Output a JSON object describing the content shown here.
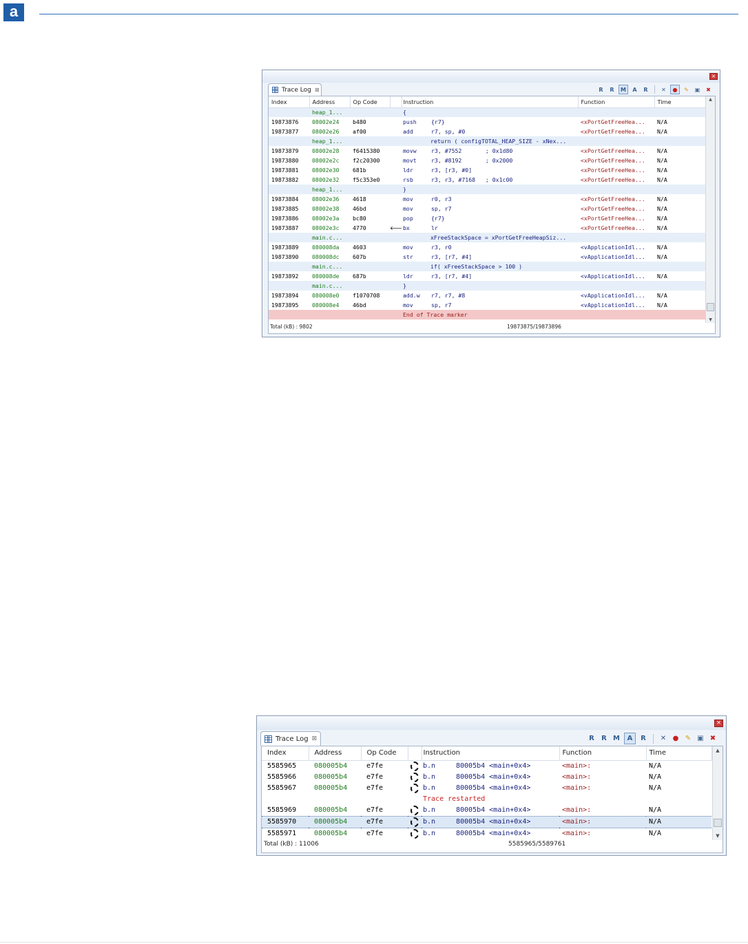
{
  "header": {
    "logo_text": "a"
  },
  "window1": {
    "tab_label": "Trace Log",
    "tab_close": "⊠",
    "columns": [
      "Index",
      "Address",
      "Op Code",
      "",
      "Instruction",
      "Function",
      "Time"
    ],
    "rows": [
      {
        "kind": "src",
        "idx": "",
        "addr": "heap_1...",
        "op": "",
        "mn": "",
        "ins": "{",
        "fn": "",
        "time": ""
      },
      {
        "kind": "ins",
        "idx": "19873876",
        "addr": "08002e24",
        "op": "b480",
        "mn": "push",
        "ins": "{r7}",
        "fn": "<xPortGetFreeHea...",
        "time": "N/A"
      },
      {
        "kind": "ins",
        "idx": "19873877",
        "addr": "08002e26",
        "op": "af00",
        "mn": "add",
        "ins": "r7, sp, #0",
        "fn": "<xPortGetFreeHea...",
        "time": "N/A"
      },
      {
        "kind": "src",
        "idx": "",
        "addr": "heap_1...",
        "op": "",
        "mn": "",
        "ins": "return ( configTOTAL_HEAP_SIZE - xNex...",
        "fn": "",
        "time": ""
      },
      {
        "kind": "ins",
        "idx": "19873879",
        "addr": "08002e28",
        "op": "f6415380",
        "mn": "movw",
        "ins": "r3, #7552       ; 0x1d80",
        "fn": "<xPortGetFreeHea...",
        "time": "N/A"
      },
      {
        "kind": "ins",
        "idx": "19873880",
        "addr": "08002e2c",
        "op": "f2c20300",
        "mn": "movt",
        "ins": "r3, #8192       ; 0x2000",
        "fn": "<xPortGetFreeHea...",
        "time": "N/A"
      },
      {
        "kind": "ins",
        "idx": "19873881",
        "addr": "08002e30",
        "op": "681b",
        "mn": "ldr",
        "ins": "r3, [r3, #0]",
        "fn": "<xPortGetFreeHea...",
        "time": "N/A"
      },
      {
        "kind": "ins",
        "idx": "19873882",
        "addr": "08002e32",
        "op": "f5c353e0",
        "mn": "rsb",
        "ins": "r3, r3, #7168   ; 0x1c00",
        "fn": "<xPortGetFreeHea...",
        "time": "N/A"
      },
      {
        "kind": "src",
        "idx": "",
        "addr": "heap_1...",
        "op": "",
        "mn": "",
        "ins": "}",
        "fn": "",
        "time": ""
      },
      {
        "kind": "ins",
        "idx": "19873884",
        "addr": "08002e36",
        "op": "4618",
        "mn": "mov",
        "ins": "r0, r3",
        "fn": "<xPortGetFreeHea...",
        "time": "N/A"
      },
      {
        "kind": "ins",
        "idx": "19873885",
        "addr": "08002e38",
        "op": "46bd",
        "mn": "mov",
        "ins": "sp, r7",
        "fn": "<xPortGetFreeHea...",
        "time": "N/A"
      },
      {
        "kind": "ins",
        "idx": "19873886",
        "addr": "08002e3a",
        "op": "bc80",
        "mn": "pop",
        "ins": "{r7}",
        "fn": "<xPortGetFreeHea...",
        "time": "N/A"
      },
      {
        "kind": "ins",
        "idx": "19873887",
        "addr": "08002e3c",
        "op": "4770",
        "arrow": "🡐",
        "mn": "bx",
        "ins": "lr",
        "fn": "<xPortGetFreeHea...",
        "time": "N/A"
      },
      {
        "kind": "src",
        "idx": "",
        "addr": "main.c...",
        "op": "",
        "mn": "",
        "ins": "xFreeStackSpace = xPortGetFreeHeapSiz...",
        "fn": "",
        "time": ""
      },
      {
        "kind": "ins",
        "idx": "19873889",
        "addr": "080008da",
        "op": "4603",
        "mn": "mov",
        "ins": "r3, r0",
        "fn": "<vApplicationIdl...",
        "time": "N/A"
      },
      {
        "kind": "ins",
        "idx": "19873890",
        "addr": "080008dc",
        "op": "607b",
        "mn": "str",
        "ins": "r3, [r7, #4]",
        "fn": "<vApplicationIdl...",
        "time": "N/A"
      },
      {
        "kind": "src",
        "idx": "",
        "addr": "main.c...",
        "op": "",
        "mn": "",
        "ins": "if( xFreeStackSpace > 100 )",
        "fn": "",
        "time": ""
      },
      {
        "kind": "ins",
        "idx": "19873892",
        "addr": "080008de",
        "op": "687b",
        "mn": "ldr",
        "ins": "r3, [r7, #4]",
        "fn": "<vApplicationIdl...",
        "time": "N/A"
      },
      {
        "kind": "src",
        "idx": "",
        "addr": "main.c...",
        "op": "",
        "mn": "",
        "ins": "}",
        "fn": "",
        "time": ""
      },
      {
        "kind": "ins",
        "idx": "19873894",
        "addr": "080008e0",
        "op": "f1070708",
        "mn": "add.w",
        "ins": "r7, r7, #8",
        "fn": "<vApplicationIdl...",
        "time": "N/A"
      },
      {
        "kind": "ins",
        "idx": "19873895",
        "addr": "080008e4",
        "op": "46bd",
        "mn": "mov",
        "ins": "sp, r7",
        "fn": "<vApplicationIdl...",
        "time": "N/A"
      },
      {
        "kind": "eot",
        "idx": "",
        "addr": "",
        "op": "",
        "mn": "End of Trace marker",
        "ins": "",
        "fn": "",
        "time": ""
      }
    ],
    "status_left": "Total (kB) : 9802",
    "status_right": "19873875/19873896"
  },
  "window2": {
    "tab_label": "Trace Log",
    "tab_close": "⊠",
    "columns": [
      "Index",
      "Address",
      "Op Code",
      "",
      "Instruction",
      "Function",
      "Time"
    ],
    "rows": [
      {
        "kind": "ins",
        "idx": "5585965",
        "addr": "080005b4",
        "op": "e7fe",
        "mn": "b.n",
        "ins": "80005b4 <main+0x4>",
        "fn": "<main>:",
        "time": "N/A"
      },
      {
        "kind": "ins",
        "idx": "5585966",
        "addr": "080005b4",
        "op": "e7fe",
        "mn": "b.n",
        "ins": "80005b4 <main+0x4>",
        "fn": "<main>:",
        "time": "N/A"
      },
      {
        "kind": "ins",
        "idx": "5585967",
        "addr": "080005b4",
        "op": "e7fe",
        "mn": "b.n",
        "ins": "80005b4 <main+0x4>",
        "fn": "<main>:",
        "time": "N/A"
      },
      {
        "kind": "restart",
        "idx": "",
        "addr": "",
        "op": "",
        "mn": "Trace restarted",
        "ins": "",
        "fn": "",
        "time": ""
      },
      {
        "kind": "ins",
        "idx": "5585969",
        "addr": "080005b4",
        "op": "e7fe",
        "mn": "b.n",
        "ins": "80005b4 <main+0x4>",
        "fn": "<main>:",
        "time": "N/A"
      },
      {
        "kind": "sel",
        "idx": "5585970",
        "addr": "080005b4",
        "op": "e7fe",
        "mn": "b.n",
        "ins": "80005b4 <main+0x4>",
        "fn": "<main>:",
        "time": "N/A"
      },
      {
        "kind": "ins",
        "idx": "5585971",
        "addr": "080005b4",
        "op": "e7fe",
        "mn": "b.n",
        "ins": "80005b4 <main+0x4>",
        "fn": "<main>:",
        "time": "N/A"
      }
    ],
    "status_left": "Total (kB) : 11006",
    "status_right": "5585965/5589761"
  },
  "toolbar_icons": [
    "zoom-prev-icon",
    "zoom-next-icon",
    "mark-icon",
    "active-filter-icon",
    "reset-icon",
    "settings-icon",
    "record-icon",
    "pin-icon",
    "save-icon",
    "delete-icon"
  ],
  "colors": {
    "address": "#1c7a1c",
    "function_red": "#9b1c1c",
    "function_blue": "#1a237e",
    "end_marker_bg": "#f4c8c8",
    "source_row_bg": "#e6eff9"
  }
}
